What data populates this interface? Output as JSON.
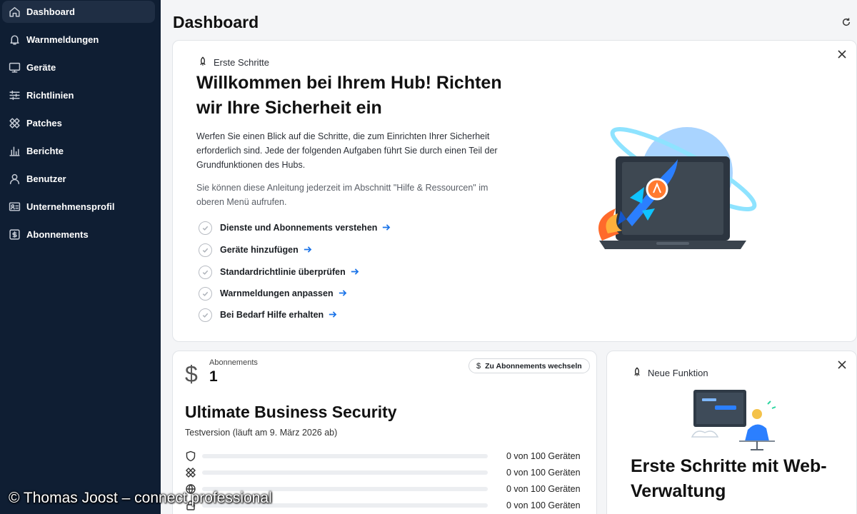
{
  "sidebar": {
    "items": [
      {
        "label": "Dashboard",
        "icon": "home-icon",
        "active": true
      },
      {
        "label": "Warnmeldungen",
        "icon": "bell-icon"
      },
      {
        "label": "Geräte",
        "icon": "monitor-icon"
      },
      {
        "label": "Richtlinien",
        "icon": "sliders-icon"
      },
      {
        "label": "Patches",
        "icon": "patch-icon"
      },
      {
        "label": "Berichte",
        "icon": "bar-chart-icon"
      },
      {
        "label": "Benutzer",
        "icon": "user-icon"
      },
      {
        "label": "Unternehmensprofil",
        "icon": "id-card-icon"
      },
      {
        "label": "Abonnements",
        "icon": "subscription-icon"
      }
    ]
  },
  "header": {
    "title": "Dashboard"
  },
  "welcome": {
    "eyebrow": "Erste Schritte",
    "title": "Willkommen bei Ihrem Hub! Richten wir Ihre Sicherheit ein",
    "para1": "Werfen Sie einen Blick auf die Schritte, die zum Einrichten Ihrer Sicherheit erforderlich sind. Jede der folgenden Aufgaben führt Sie durch einen Teil der Grundfunktionen des Hubs.",
    "para2": "Sie können diese Anleitung jederzeit im Abschnitt \"Hilfe & Ressourcen\" im oberen Menü aufrufen.",
    "steps": [
      {
        "label": "Dienste und Abonnements verstehen"
      },
      {
        "label": "Geräte hinzufügen"
      },
      {
        "label": "Standardrichtlinie überprüfen"
      },
      {
        "label": "Warnmeldungen anpassen"
      },
      {
        "label": "Bei Bedarf Hilfe erhalten"
      }
    ]
  },
  "subscription": {
    "label": "Abonnements",
    "count": "1",
    "currency_symbol": "$",
    "switch_label": "Zu Abonnements wechseln",
    "plan_title": "Ultimate Business Security",
    "plan_status": "Testversion (läuft am 9. März 2026 ab)",
    "usage": [
      {
        "icon": "shield-icon",
        "used": 0,
        "total": 100,
        "text": "0 von 100 Geräten"
      },
      {
        "icon": "patch-icon",
        "used": 0,
        "total": 100,
        "text": "0 von 100 Geräten"
      },
      {
        "icon": "globe-icon",
        "used": 0,
        "total": 100,
        "text": "0 von 100 Geräten"
      },
      {
        "icon": "lock-icon",
        "used": 0,
        "total": 100,
        "text": "0 von 100 Geräten"
      }
    ]
  },
  "feature": {
    "eyebrow": "Neue Funktion",
    "title": "Erste Schritte mit Web-Verwaltung"
  },
  "watermark": "© Thomas Joost – connect professional",
  "colors": {
    "sidebar": "#0f1e33",
    "accent": "#1a73e8"
  }
}
